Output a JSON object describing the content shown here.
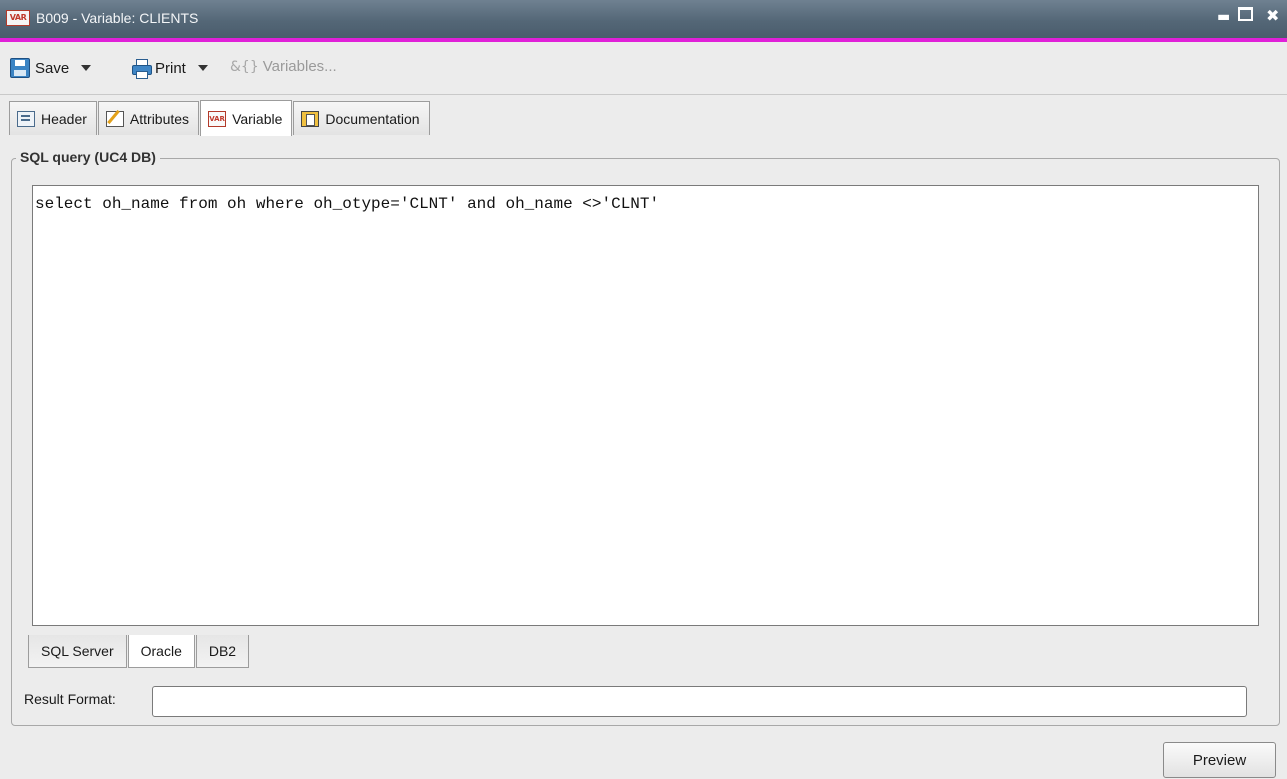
{
  "window": {
    "icon_text": "VAR",
    "title": "B009 - Variable: CLIENTS",
    "controls": {
      "minimize": "▬",
      "close": "✖"
    }
  },
  "toolbar": {
    "save_label": "Save",
    "print_label": "Print",
    "variables_label": "Variables...",
    "variables_icon": "&{}"
  },
  "tabs": [
    {
      "label": "Header",
      "icon": "header-icon",
      "active": false
    },
    {
      "label": "Attributes",
      "icon": "attributes-icon",
      "active": false
    },
    {
      "label": "Variable",
      "icon": "var-icon",
      "active": true
    },
    {
      "label": "Documentation",
      "icon": "documentation-icon",
      "active": false
    }
  ],
  "tab_var_icon_text": "VAR",
  "sql_group": {
    "title": "SQL query (UC4 DB)",
    "query": "select oh_name from oh where oh_otype='CLNT' and oh_name <>'CLNT'"
  },
  "db_tabs": [
    {
      "label": "SQL Server",
      "active": false
    },
    {
      "label": "Oracle",
      "active": true
    },
    {
      "label": "DB2",
      "active": false
    }
  ],
  "result_format": {
    "label": "Result Format:",
    "value": ""
  },
  "preview_label": "Preview",
  "colors": {
    "accent_line": "#e020d8",
    "titlebar": "#546777"
  }
}
